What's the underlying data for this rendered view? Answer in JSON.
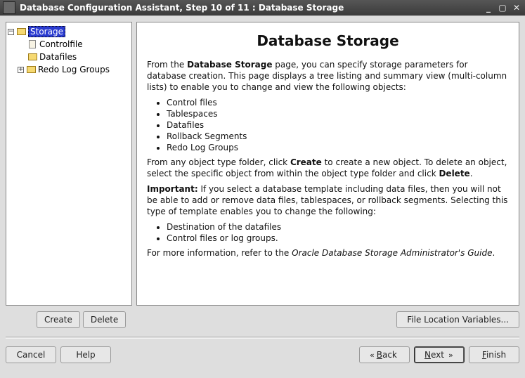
{
  "window": {
    "title": "Database Configuration Assistant, Step 10 of 11 : Database Storage"
  },
  "tree": {
    "root": "Storage",
    "items": [
      {
        "label": "Controlfile"
      },
      {
        "label": "Datafiles"
      },
      {
        "label": "Redo Log Groups"
      }
    ]
  },
  "main": {
    "heading": "Database Storage",
    "intro_pre": "From the ",
    "intro_bold": "Database Storage",
    "intro_post": " page, you can specify storage parameters for database creation. This page displays a tree listing and summary view (multi-column lists) to enable you to change and view the following objects:",
    "objects": [
      "Control files",
      "Tablespaces",
      "Datafiles",
      "Rollback Segments",
      "Redo Log Groups"
    ],
    "create_pre": "From any object type folder, click ",
    "create_b1": "Create",
    "create_mid": " to create a new object. To delete an object, select the specific object from within the object type folder and click ",
    "create_b2": "Delete",
    "create_post": ".",
    "important_label": "Important:",
    "important_text": " If you select a database template including data files, then you will not be able to add or remove data files, tablespaces, or rollback segments. Selecting this type of template enables you to change the following:",
    "important_list": [
      "Destination of the datafiles",
      "Control files or log groups."
    ],
    "more_pre": "For more information, refer to the ",
    "more_italic": "Oracle Database Storage Administrator's Guide",
    "more_post": "."
  },
  "buttons": {
    "create": "Create",
    "delete": "Delete",
    "file_loc": "File Location Variables...",
    "cancel": "Cancel",
    "help": "Help",
    "back": "Back",
    "next": "Next",
    "finish": "Finish"
  }
}
